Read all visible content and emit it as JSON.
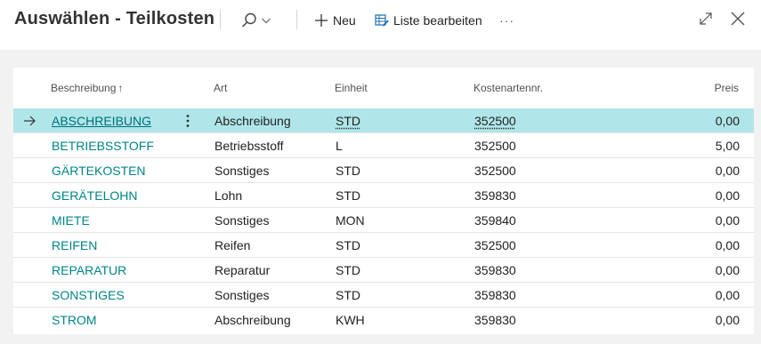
{
  "header": {
    "title": "Auswählen - Teilkosten",
    "new_label": "Neu",
    "edit_list_label": "Liste bearbeiten",
    "more_label": "···"
  },
  "table": {
    "columns": {
      "description": "Beschreibung",
      "sort_indicator": "↑",
      "type": "Art",
      "unit": "Einheit",
      "account": "Kostenartennr.",
      "price": "Preis"
    },
    "rows": [
      {
        "description": "ABSCHREIBUNG",
        "type": "Abschreibung",
        "unit": "STD",
        "account": "352500",
        "price": "0,00"
      },
      {
        "description": "BETRIEBSSTOFF",
        "type": "Betriebsstoff",
        "unit": "L",
        "account": "352500",
        "price": "5,00"
      },
      {
        "description": "GÄRTEKOSTEN",
        "type": "Sonstiges",
        "unit": "STD",
        "account": "352500",
        "price": "0,00"
      },
      {
        "description": "GERÄTELOHN",
        "type": "Lohn",
        "unit": "STD",
        "account": "359830",
        "price": "0,00"
      },
      {
        "description": "MIETE",
        "type": "Sonstiges",
        "unit": "MON",
        "account": "359840",
        "price": "0,00"
      },
      {
        "description": "REIFEN",
        "type": "Reifen",
        "unit": "STD",
        "account": "352500",
        "price": "0,00"
      },
      {
        "description": "REPARATUR",
        "type": "Reparatur",
        "unit": "STD",
        "account": "359830",
        "price": "0,00"
      },
      {
        "description": "SONSTIGES",
        "type": "Sonstiges",
        "unit": "STD",
        "account": "359830",
        "price": "0,00"
      },
      {
        "description": "STROM",
        "type": "Abschreibung",
        "unit": "KWH",
        "account": "359830",
        "price": "0,00"
      }
    ]
  },
  "colors": {
    "accent": "#008489",
    "selected_row": "#b0e6e9",
    "background": "#f2f2f2"
  },
  "icons": {
    "search": "search-icon",
    "dropdown": "chevron-down-icon",
    "new": "plus-icon",
    "edit_list": "edit-list-icon",
    "expand": "expand-icon",
    "close": "close-icon",
    "row_pointer": "arrow-right-icon",
    "row_menu": "kebab-menu-icon"
  }
}
